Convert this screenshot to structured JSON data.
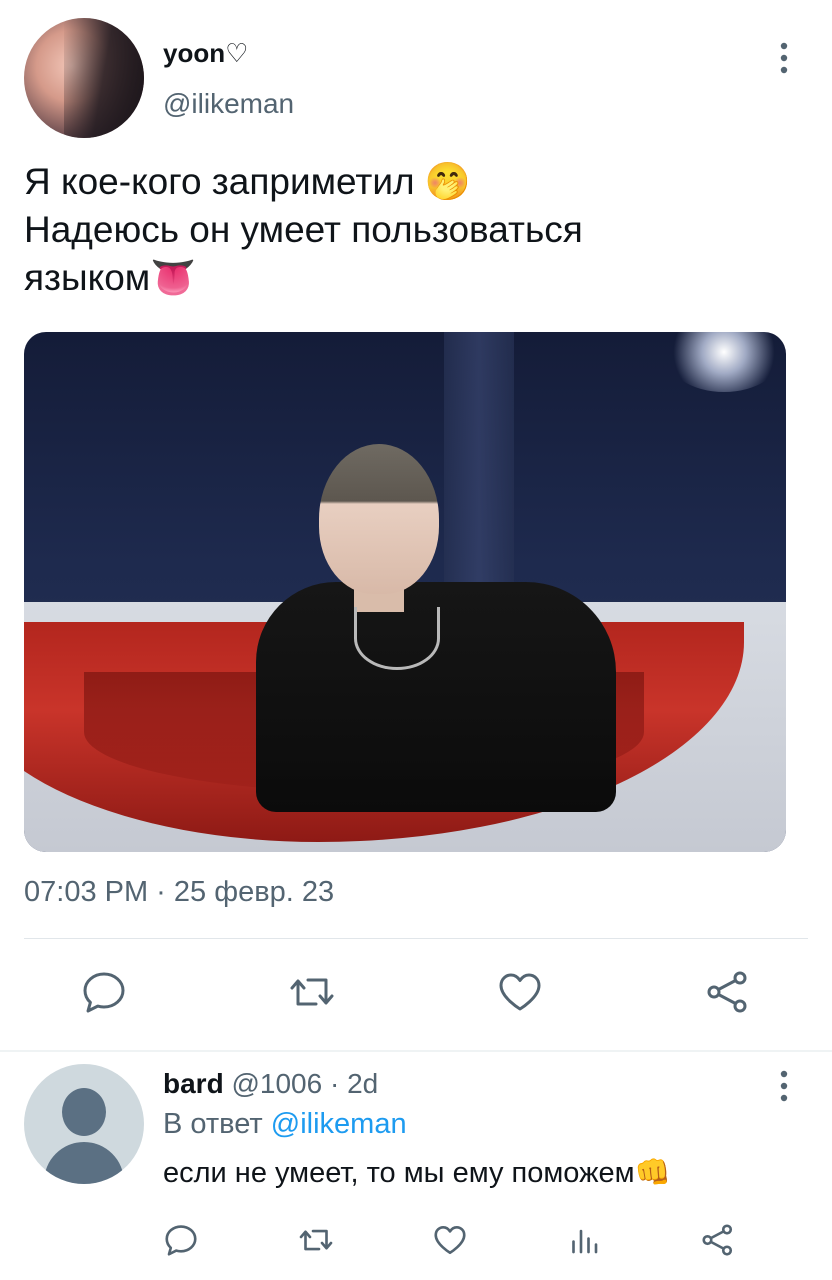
{
  "tweet": {
    "display_name": "yoon♡",
    "handle": "@ilikeman",
    "text_lines": [
      "Я кое-кого заприметил 🤭",
      "Надеюсь он умеет пользоваться",
      "языком👅"
    ],
    "timestamp": "07:03 PM · 25 февр. 23"
  },
  "actions": {
    "reply_icon": "comment-icon",
    "retweet_icon": "retweet-icon",
    "like_icon": "heart-icon",
    "share_icon": "share-icon"
  },
  "reply": {
    "name": "bard",
    "handle_and_time": "@1006 · 2d",
    "replying_prefix": "В ответ",
    "replying_mention": "@ilikeman",
    "text": "если не умеет, то мы ему поможем👊"
  },
  "colors": {
    "text": "#0f1419",
    "muted": "#536471",
    "link": "#1d9bf0",
    "divider": "#e1e6ea"
  }
}
